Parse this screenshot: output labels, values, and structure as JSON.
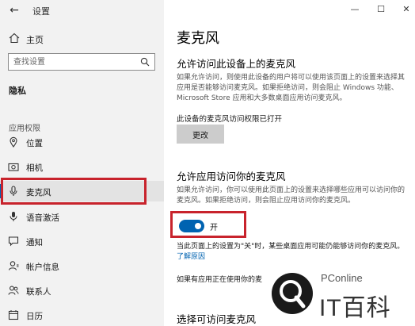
{
  "window": {
    "title": "设置"
  },
  "sidebar": {
    "home_label": "主页",
    "search_placeholder": "查找设置",
    "group_header": "隐私",
    "section_label": "应用权限",
    "items": [
      {
        "label": "位置",
        "icon": "location-icon"
      },
      {
        "label": "相机",
        "icon": "camera-icon"
      },
      {
        "label": "麦克风",
        "icon": "microphone-icon",
        "selected": true
      },
      {
        "label": "语音激活",
        "icon": "voice-activation-icon"
      },
      {
        "label": "通知",
        "icon": "notification-icon"
      },
      {
        "label": "帐户信息",
        "icon": "account-info-icon"
      },
      {
        "label": "联系人",
        "icon": "contacts-icon"
      },
      {
        "label": "日历",
        "icon": "calendar-icon"
      }
    ]
  },
  "main": {
    "page_title": "麦克风",
    "device_section": {
      "heading": "允许访问此设备上的麦克风",
      "description": "如果允许访问，则使用此设备的用户将可以使用该页面上的设置来选择其应用是否能够访问麦克风。如果拒绝访问，则会阻止 Windows 功能、Microsoft Store 应用和大多数桌面应用访问麦克风。",
      "status": "此设备的麦克风访问权限已打开",
      "change_button": "更改"
    },
    "app_section": {
      "heading": "允许应用访问你的麦克风",
      "description": "如果允许访问，你可以使用此页面上的设置来选择哪些应用可以访问你的麦克风。如果拒绝访问，则会阻止应用访问你的麦克风。",
      "toggle_state_label": "开",
      "toggle_on": true,
      "note_text": "当此页面上的设置为\"关\"时，某些桌面应用可能仍能够访问你的麦克风。",
      "note_link": "了解原因",
      "note2": "如果有应用正在使用你的麦"
    },
    "bottom_heading": "选择可访问麦克风"
  },
  "watermark": {
    "brand": "PConline",
    "name": "IT百科"
  },
  "colors": {
    "accent": "#0063b1",
    "highlight_border": "#c8232c",
    "sidebar_bg": "#f2f2f2"
  }
}
